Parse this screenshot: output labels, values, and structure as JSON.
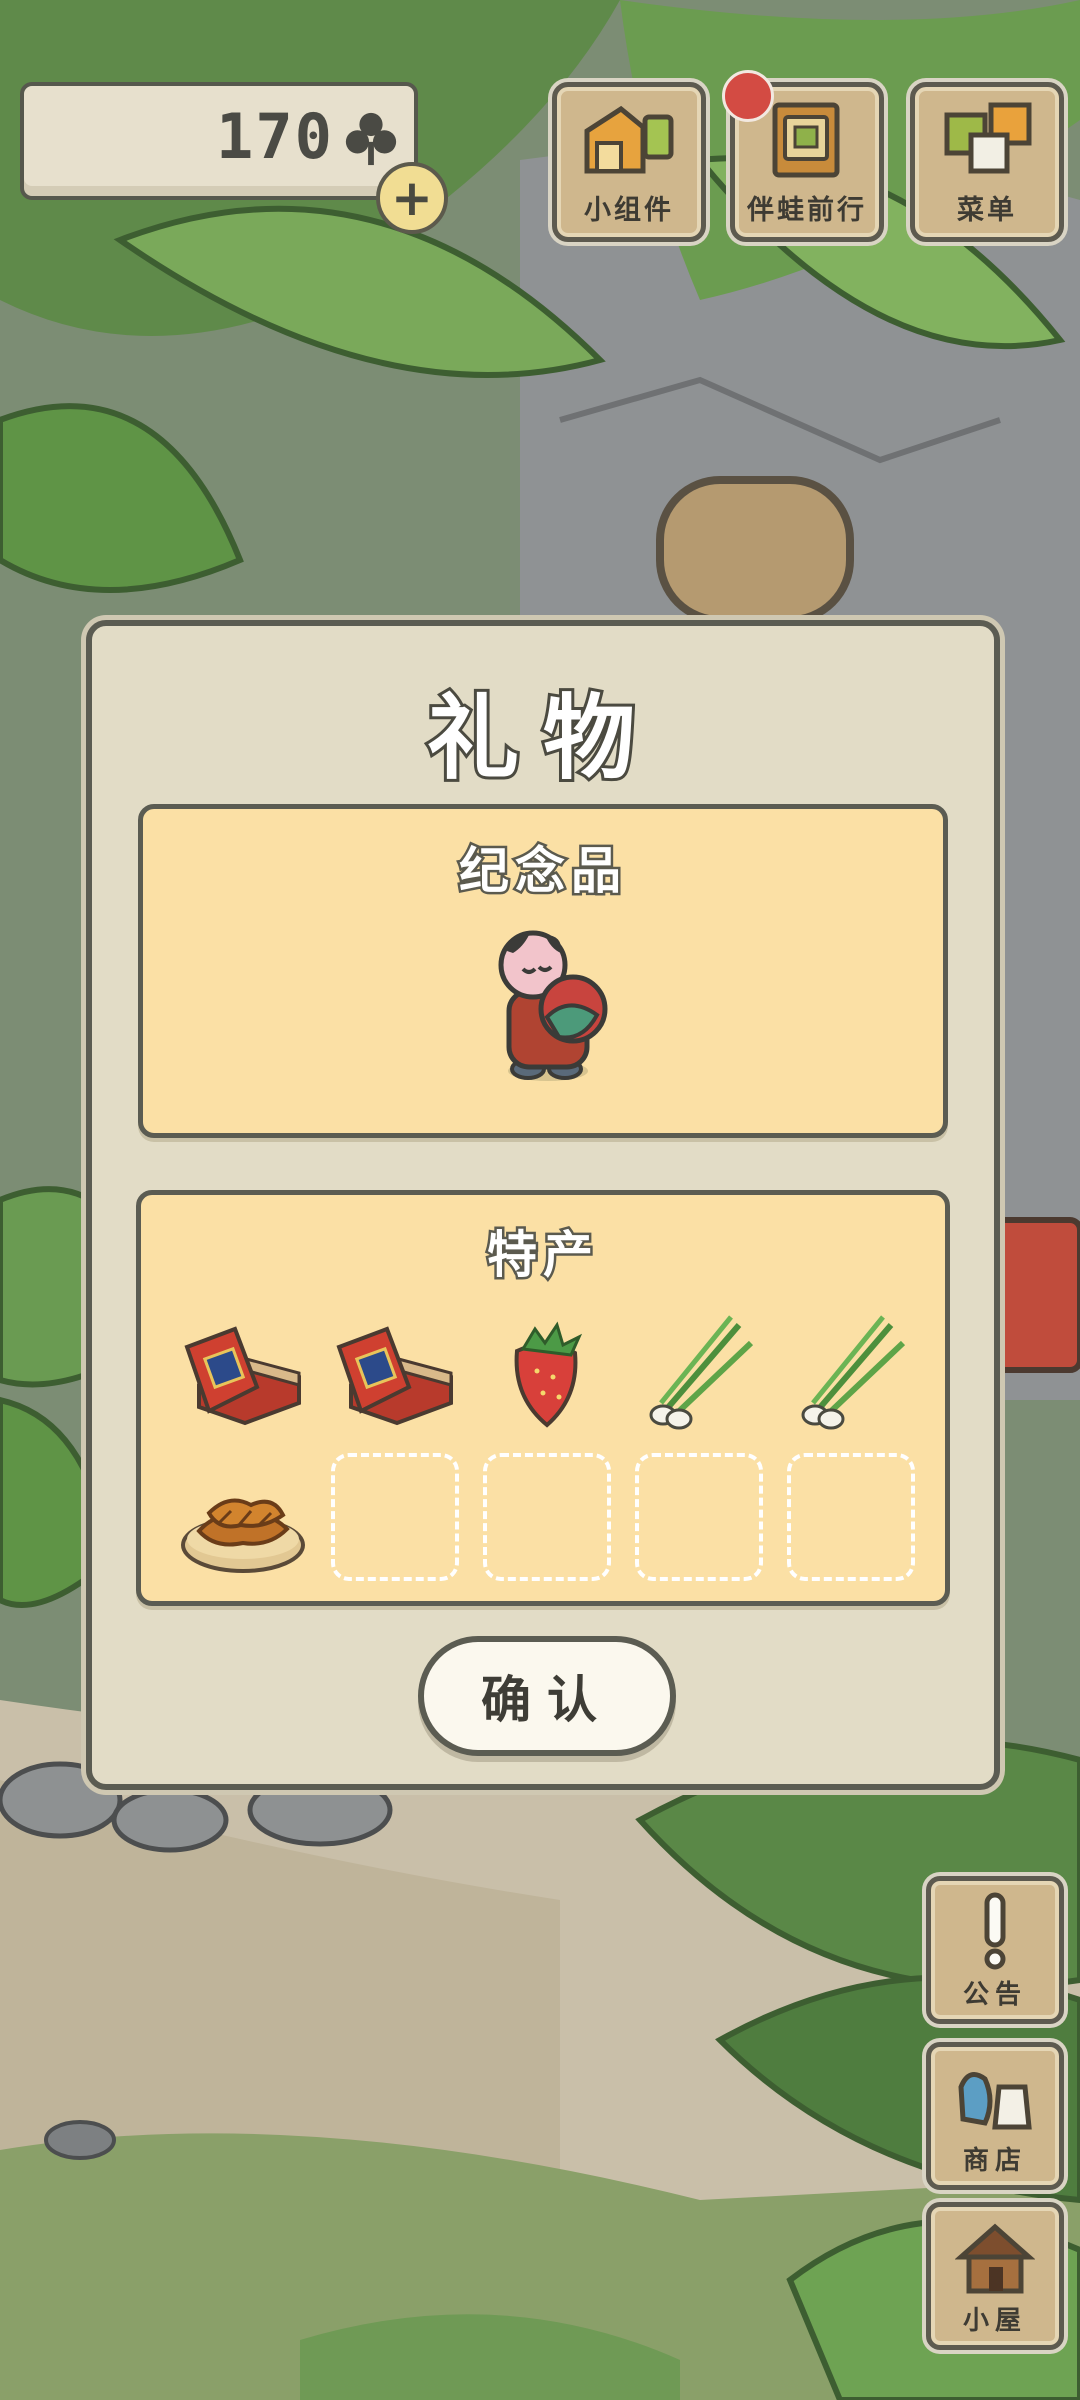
{
  "currency": {
    "clover_count": "170",
    "icon": "clover-icon",
    "add_icon": "plus-icon"
  },
  "top_menu": [
    {
      "label": "小组件",
      "icon": "widget-icon"
    },
    {
      "label": "伴蛙前行",
      "icon": "album-icon",
      "has_notification": true
    },
    {
      "label": "菜单",
      "icon": "menu-icon"
    }
  ],
  "side_menu": [
    {
      "label": "公告",
      "icon": "exclamation-icon"
    },
    {
      "label": "商店",
      "icon": "shop-bag-icon"
    },
    {
      "label": "小屋",
      "icon": "house-icon"
    }
  ],
  "dialog": {
    "title": "礼物",
    "souvenir": {
      "title": "纪念品",
      "item": "doll-figurine"
    },
    "specialty": {
      "title": "特产",
      "items": [
        "gift-box",
        "gift-box",
        "strawberry",
        "green-onion",
        "green-onion",
        "fried-dough-twists",
        "",
        "",
        "",
        ""
      ]
    },
    "confirm_label": "确认"
  },
  "colors": {
    "panel": "#fbe0a5",
    "dialog": "#e2dcc6",
    "border": "#5b5c52",
    "badge": "#d34b43"
  }
}
